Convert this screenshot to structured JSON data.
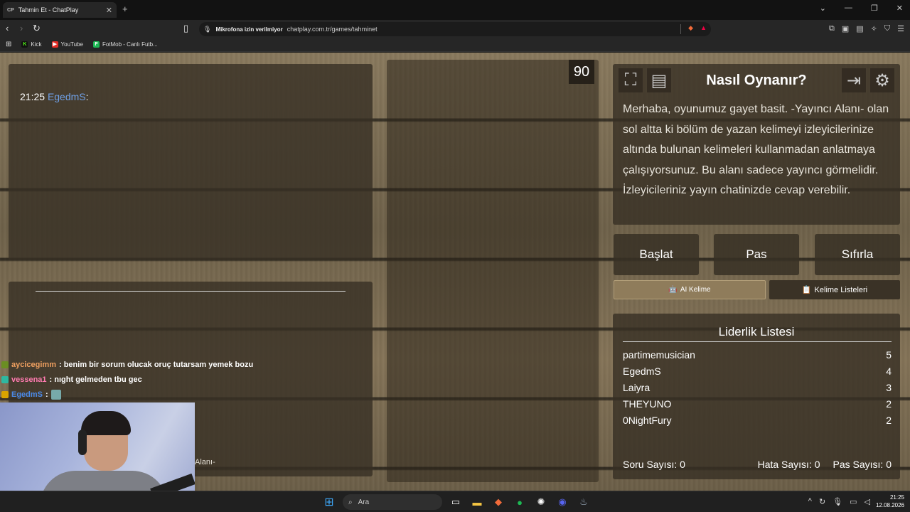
{
  "browser": {
    "tab_title": "Tahmin Et - ChatPlay",
    "tab_favicon": "CP",
    "url_permission": "Mikrofona izin verilmiyor",
    "url": "chatplay.com.tr/games/tahminet",
    "bookmarks": [
      "Kick",
      "YouTube",
      "FotMob - Canlı Futb..."
    ]
  },
  "chat_top": {
    "time": "21:25",
    "user": "EgedmS",
    "suffix": ":"
  },
  "timer": "90",
  "how": {
    "title": "Nasıl Oynanır?",
    "text": "Merhaba, oyunumuz gayet basit. -Yayıncı Alanı- olan sol altta ki bölüm de yazan kelimeyi izleyicilerinize altında bulunan kelimeleri kullanmadan anlatmaya çalışıyorsunuz. Bu alanı sadece yayıncı görmelidir. İzleyicileriniz yayın chatinizde cevap verebilir."
  },
  "buttons": {
    "start": "Başlat",
    "pass": "Pas",
    "reset": "Sıfırla",
    "ai": "AI Kelime",
    "lists": "Kelime Listeleri"
  },
  "leaderboard": {
    "title": "Liderlik Listesi",
    "rows": [
      {
        "name": "partimemusician",
        "score": "5"
      },
      {
        "name": "EgedmS",
        "score": "4"
      },
      {
        "name": "Laiyra",
        "score": "3"
      },
      {
        "name": "THEYUNO",
        "score": "2"
      },
      {
        "name": "0NightFury",
        "score": "2"
      }
    ],
    "question_count": "Soru Sayısı: 0",
    "error_count": "Hata Sayısı: 0",
    "pass_count": "Pas Sayısı: 0"
  },
  "stream_chat": [
    {
      "user": "aycicegimm",
      "color": "#f0a060",
      "text": ": benim bir sorum olucak oruç tutarsam yemek bozu"
    },
    {
      "user": "vessena1",
      "color": "#ff7bb0",
      "text": ": nıght gelmeden tbu gec"
    },
    {
      "user": "EgedmS",
      "color": "#4a88e6",
      "text": ":"
    }
  ],
  "streamer_area_label": "Alanı-",
  "taskbar": {
    "search": "Ara",
    "time": "21:25",
    "date": "12.08.2026"
  }
}
